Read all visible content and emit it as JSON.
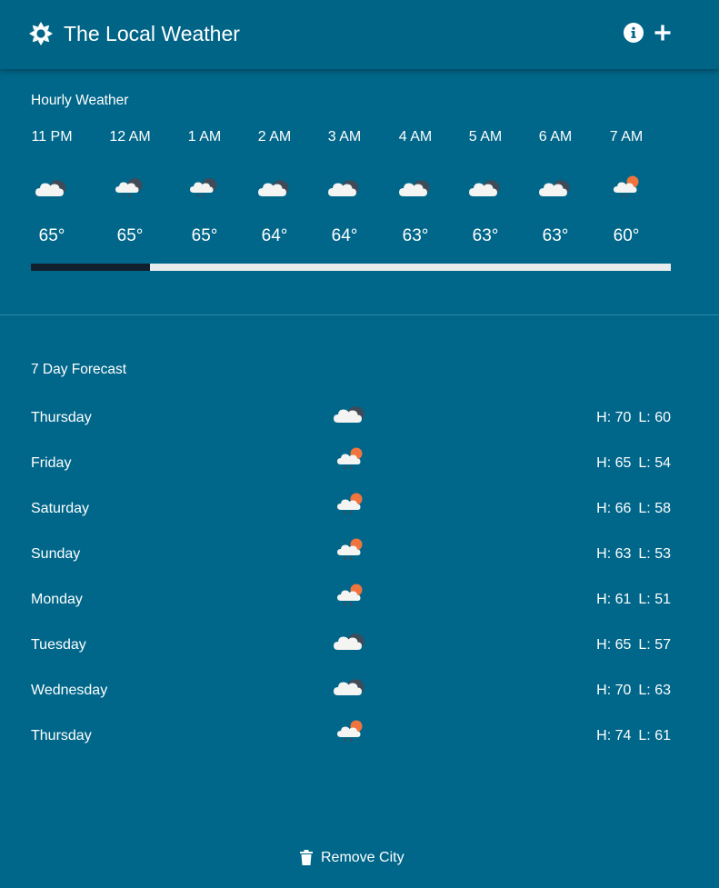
{
  "header": {
    "title": "The Local Weather",
    "logo_icon": "sun-icon",
    "info_icon": "info-icon",
    "add_icon": "plus-icon"
  },
  "hourly": {
    "title": "Hourly Weather",
    "hours": [
      {
        "time": "11 PM",
        "temp": "65°",
        "icon": "cloudy-night-icon"
      },
      {
        "time": "12 AM",
        "temp": "65°",
        "icon": "cloudy-night-rain-icon"
      },
      {
        "time": "1 AM",
        "temp": "65°",
        "icon": "cloudy-night-rain-icon"
      },
      {
        "time": "2 AM",
        "temp": "64°",
        "icon": "cloudy-night-icon"
      },
      {
        "time": "3 AM",
        "temp": "64°",
        "icon": "cloudy-night-icon"
      },
      {
        "time": "4 AM",
        "temp": "63°",
        "icon": "cloudy-night-icon"
      },
      {
        "time": "5 AM",
        "temp": "63°",
        "icon": "cloudy-night-icon"
      },
      {
        "time": "6 AM",
        "temp": "63°",
        "icon": "cloudy-night-icon"
      },
      {
        "time": "7 AM",
        "temp": "60°",
        "icon": "partly-cloudy-day-rain-icon"
      }
    ],
    "scroll_progress": 0.186
  },
  "forecast": {
    "title": "7 Day Forecast",
    "days": [
      {
        "day": "Thursday",
        "high": "H: 70",
        "low": "L: 60",
        "icon": "cloudy-night-icon"
      },
      {
        "day": "Friday",
        "high": "H: 65",
        "low": "L: 54",
        "icon": "partly-cloudy-day-rain-icon"
      },
      {
        "day": "Saturday",
        "high": "H: 66",
        "low": "L: 58",
        "icon": "partly-cloudy-day-rain-icon"
      },
      {
        "day": "Sunday",
        "high": "H: 63",
        "low": "L: 53",
        "icon": "partly-cloudy-day-rain-icon"
      },
      {
        "day": "Monday",
        "high": "H: 61",
        "low": "L: 51",
        "icon": "partly-cloudy-day-rain-icon"
      },
      {
        "day": "Tuesday",
        "high": "H: 65",
        "low": "L: 57",
        "icon": "cloudy-night-icon"
      },
      {
        "day": "Wednesday",
        "high": "H: 70",
        "low": "L: 63",
        "icon": "cloudy-night-icon"
      },
      {
        "day": "Thursday",
        "high": "H: 74",
        "low": "L: 61",
        "icon": "partly-cloudy-day-rain-icon"
      }
    ]
  },
  "footer": {
    "remove_label": "Remove City",
    "remove_icon": "trash-icon"
  },
  "colors": {
    "background": "#00678a",
    "header": "#006487",
    "scroll_thumb": "#10202f",
    "scroll_track": "#e9ecec",
    "sun_accent": "#f0743e"
  }
}
